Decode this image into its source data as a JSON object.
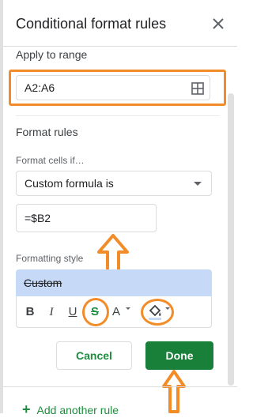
{
  "panel": {
    "title": "Conditional format rules",
    "close_icon": "close-icon"
  },
  "apply_range": {
    "label": "Apply to range",
    "value": "A2:A6",
    "icon": "grid-select-icon"
  },
  "format_rules": {
    "label": "Format rules",
    "format_cells_if_label": "Format cells if…",
    "condition_selected": "Custom formula is",
    "formula_value": "=$B2"
  },
  "formatting_style": {
    "label": "Formatting style",
    "preview_text": "Custom",
    "preview_bg": "#c6d9f7",
    "toolbar": {
      "bold": "B",
      "italic": "I",
      "underline": "U",
      "strikethrough": "S",
      "text_color": "A",
      "fill_color_icon": "fill-color-icon"
    }
  },
  "actions": {
    "cancel_label": "Cancel",
    "done_label": "Done",
    "accent": "#188038"
  },
  "footer": {
    "add_rule_label": "Add another rule"
  },
  "annotations": {
    "color": "#f28c28"
  }
}
